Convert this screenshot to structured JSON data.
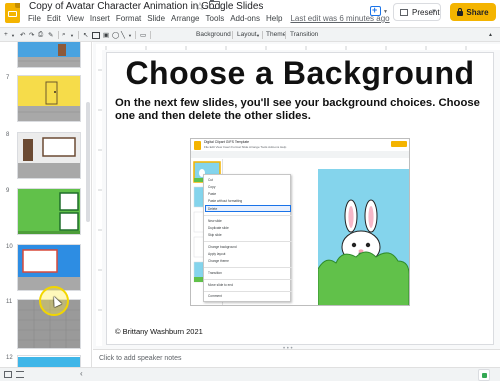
{
  "header": {
    "doc_title": "Copy of Avatar Character Animation in Google Slides",
    "menu": [
      "File",
      "Edit",
      "View",
      "Insert",
      "Format",
      "Slide",
      "Arrange",
      "Tools",
      "Add-ons",
      "Help"
    ],
    "last_edit": "Last edit was 6 minutes ago",
    "present_label": "Present",
    "share_label": "Share"
  },
  "toolbar": {
    "background_label": "Background",
    "layout_label": "Layout",
    "theme_label": "Theme",
    "transition_label": "Transition"
  },
  "sidebar": {
    "slide_numbers": [
      "7",
      "8",
      "9",
      "10",
      "11",
      "12"
    ]
  },
  "slide": {
    "title": "Choose a Background",
    "subtitle": "On the next few slides, you'll see your background choices. Choose one and then delete the other slides.",
    "credit": "© Brittany Washburn 2021",
    "embedded": {
      "window_title": "Digital Clipart GIFS Template",
      "context_menu": [
        "Cut",
        "Copy",
        "Paste",
        "Paste without formatting",
        "Delete",
        "New slide",
        "Duplicate slide",
        "Skip slide",
        "Change background",
        "Apply layout",
        "Change theme",
        "Transition",
        "Move slide to end",
        "Comment"
      ]
    }
  },
  "notes": {
    "placeholder": "Click to add speaker notes"
  },
  "colors": {
    "accent": "#f4b400",
    "sky": "#84d4ec",
    "grass": "#61c14a",
    "selection": "#1a73e8"
  }
}
